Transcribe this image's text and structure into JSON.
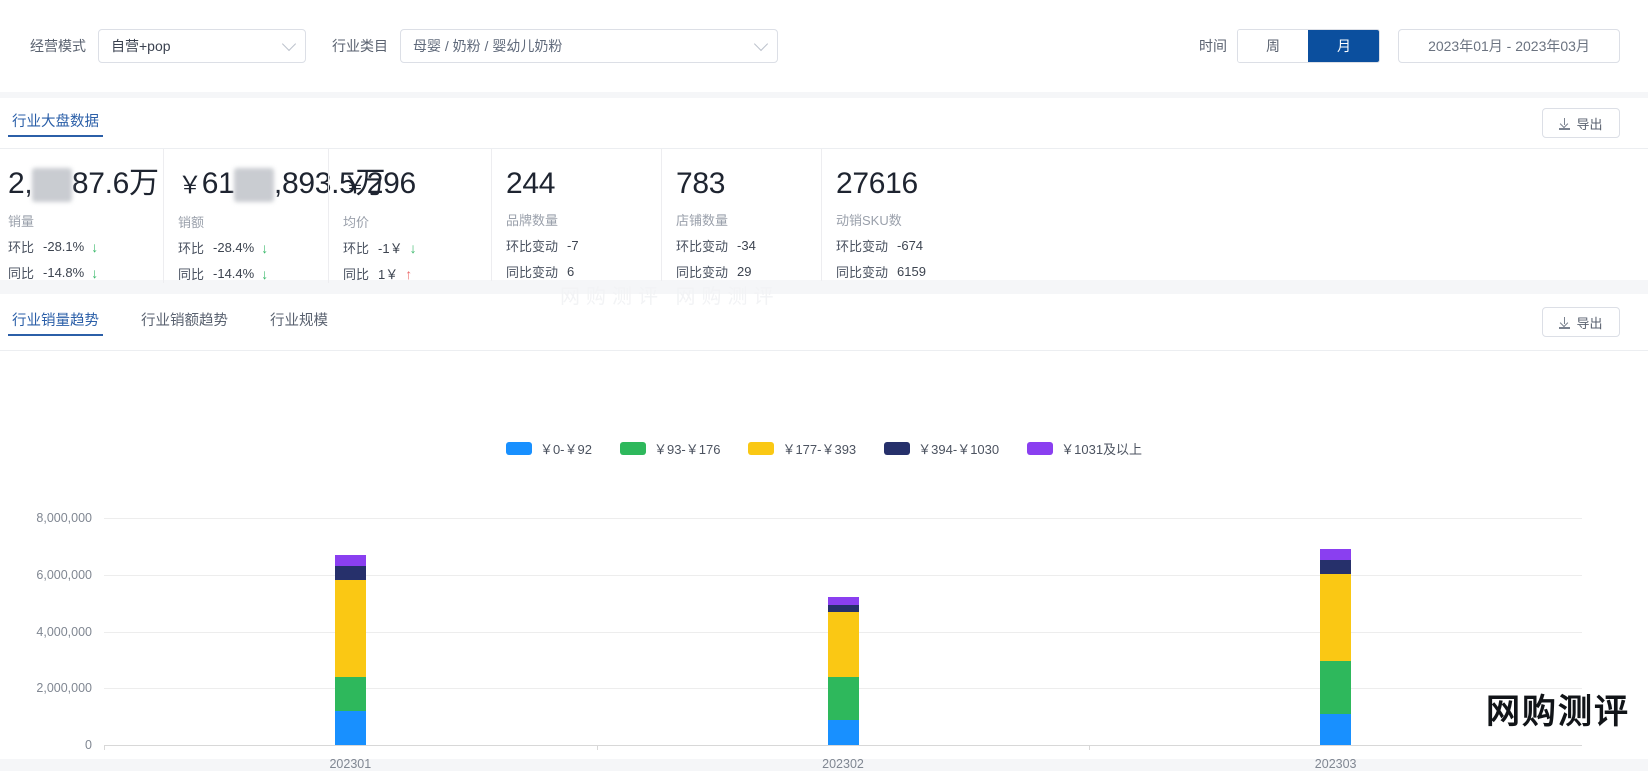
{
  "filters": {
    "mode_label": "经营模式",
    "mode_value": "自营+pop",
    "category_label": "行业类目",
    "category_value": "母婴 / 奶粉 / 婴幼儿奶粉",
    "time_label": "时间",
    "period_week": "周",
    "period_month": "月",
    "date_range": "2023年01月 - 2023年03月"
  },
  "overview": {
    "tab_label": "行业大盘数据",
    "export_label": "导出",
    "metrics": [
      {
        "value_prefix": "",
        "value_head": "2,",
        "value_masked": "XX",
        "value_tail": "87.6万",
        "label": "销量",
        "rows": [
          {
            "key": "环比",
            "value": "-28.1%",
            "dir": "down"
          },
          {
            "key": "同比",
            "value": "-14.8%",
            "dir": "down"
          }
        ]
      },
      {
        "value_prefix": "￥",
        "value_head": "61",
        "value_masked": "XX",
        "value_tail": ",893.5万",
        "label": "销额",
        "rows": [
          {
            "key": "环比",
            "value": "-28.4%",
            "dir": "down"
          },
          {
            "key": "同比",
            "value": "-14.4%",
            "dir": "down"
          }
        ]
      },
      {
        "value_prefix": "￥",
        "value_head": "296",
        "value_masked": "",
        "value_tail": "",
        "label": "均价",
        "rows": [
          {
            "key": "环比",
            "value": "-1￥",
            "dir": "down"
          },
          {
            "key": "同比",
            "value": "1￥",
            "dir": "up"
          }
        ]
      },
      {
        "value_prefix": "",
        "value_head": "244",
        "value_masked": "",
        "value_tail": "",
        "label": "品牌数量",
        "rows": [
          {
            "key": "环比变动",
            "value": "-7",
            "dir": "none"
          },
          {
            "key": "同比变动",
            "value": "6",
            "dir": "none"
          }
        ]
      },
      {
        "value_prefix": "",
        "value_head": "783",
        "value_masked": "",
        "value_tail": "",
        "label": "店铺数量",
        "rows": [
          {
            "key": "环比变动",
            "value": "-34",
            "dir": "none"
          },
          {
            "key": "同比变动",
            "value": "29",
            "dir": "none"
          }
        ]
      },
      {
        "value_prefix": "",
        "value_head": "27616",
        "value_masked": "",
        "value_tail": "",
        "label": "动销SKU数",
        "rows": [
          {
            "key": "环比变动",
            "value": "-674",
            "dir": "none"
          },
          {
            "key": "同比变动",
            "value": "6159",
            "dir": "none"
          }
        ]
      }
    ]
  },
  "trend": {
    "tabs": [
      {
        "label": "行业销量趋势",
        "active": true
      },
      {
        "label": "行业销额趋势",
        "active": false
      },
      {
        "label": "行业规模",
        "active": false
      }
    ],
    "export_label": "导出"
  },
  "watermark": "网购测评",
  "ghost_watermark": "网购测评 网购测评",
  "chart_data": {
    "type": "bar",
    "stacked": true,
    "title": "",
    "xlabel": "",
    "ylabel": "",
    "categories": [
      "202301",
      "202302",
      "202303"
    ],
    "ylim": [
      0,
      8000000
    ],
    "yticks": [
      0,
      2000000,
      4000000,
      6000000,
      8000000
    ],
    "ytick_labels": [
      "0",
      "2,000,000",
      "4,000,000",
      "6,000,000",
      "8,000,000"
    ],
    "grid": true,
    "legend_position": "top-center",
    "series": [
      {
        "name": "￥0-￥92",
        "color": "#1890ff",
        "values": [
          1200000,
          880000,
          1090000
        ]
      },
      {
        "name": "￥93-￥176",
        "color": "#2eb85c",
        "values": [
          1200000,
          1500000,
          1870000
        ]
      },
      {
        "name": "￥177-￥393",
        "color": "#fac814",
        "values": [
          3410000,
          2290000,
          3070000
        ]
      },
      {
        "name": "￥394-￥1030",
        "color": "#26306b",
        "values": [
          500000,
          250000,
          490000
        ]
      },
      {
        "name": "￥1031及以上",
        "color": "#8a3ff0",
        "values": [
          390000,
          300000,
          390000
        ]
      }
    ],
    "totals": [
      6700000,
      5220000,
      6910000
    ]
  }
}
